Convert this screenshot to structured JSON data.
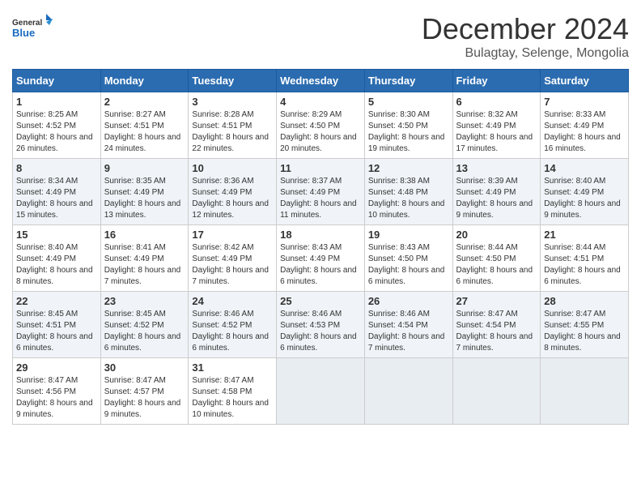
{
  "header": {
    "logo_general": "General",
    "logo_blue": "Blue",
    "month_title": "December 2024",
    "subtitle": "Bulagtay, Selenge, Mongolia"
  },
  "days_of_week": [
    "Sunday",
    "Monday",
    "Tuesday",
    "Wednesday",
    "Thursday",
    "Friday",
    "Saturday"
  ],
  "weeks": [
    [
      {
        "day": "1",
        "sunrise": "8:25 AM",
        "sunset": "4:52 PM",
        "daylight": "8 hours and 26 minutes"
      },
      {
        "day": "2",
        "sunrise": "8:27 AM",
        "sunset": "4:51 PM",
        "daylight": "8 hours and 24 minutes"
      },
      {
        "day": "3",
        "sunrise": "8:28 AM",
        "sunset": "4:51 PM",
        "daylight": "8 hours and 22 minutes"
      },
      {
        "day": "4",
        "sunrise": "8:29 AM",
        "sunset": "4:50 PM",
        "daylight": "8 hours and 20 minutes"
      },
      {
        "day": "5",
        "sunrise": "8:30 AM",
        "sunset": "4:50 PM",
        "daylight": "8 hours and 19 minutes"
      },
      {
        "day": "6",
        "sunrise": "8:32 AM",
        "sunset": "4:49 PM",
        "daylight": "8 hours and 17 minutes"
      },
      {
        "day": "7",
        "sunrise": "8:33 AM",
        "sunset": "4:49 PM",
        "daylight": "8 hours and 16 minutes"
      }
    ],
    [
      {
        "day": "8",
        "sunrise": "8:34 AM",
        "sunset": "4:49 PM",
        "daylight": "8 hours and 15 minutes"
      },
      {
        "day": "9",
        "sunrise": "8:35 AM",
        "sunset": "4:49 PM",
        "daylight": "8 hours and 13 minutes"
      },
      {
        "day": "10",
        "sunrise": "8:36 AM",
        "sunset": "4:49 PM",
        "daylight": "8 hours and 12 minutes"
      },
      {
        "day": "11",
        "sunrise": "8:37 AM",
        "sunset": "4:49 PM",
        "daylight": "8 hours and 11 minutes"
      },
      {
        "day": "12",
        "sunrise": "8:38 AM",
        "sunset": "4:48 PM",
        "daylight": "8 hours and 10 minutes"
      },
      {
        "day": "13",
        "sunrise": "8:39 AM",
        "sunset": "4:49 PM",
        "daylight": "8 hours and 9 minutes"
      },
      {
        "day": "14",
        "sunrise": "8:40 AM",
        "sunset": "4:49 PM",
        "daylight": "8 hours and 9 minutes"
      }
    ],
    [
      {
        "day": "15",
        "sunrise": "8:40 AM",
        "sunset": "4:49 PM",
        "daylight": "8 hours and 8 minutes"
      },
      {
        "day": "16",
        "sunrise": "8:41 AM",
        "sunset": "4:49 PM",
        "daylight": "8 hours and 7 minutes"
      },
      {
        "day": "17",
        "sunrise": "8:42 AM",
        "sunset": "4:49 PM",
        "daylight": "8 hours and 7 minutes"
      },
      {
        "day": "18",
        "sunrise": "8:43 AM",
        "sunset": "4:49 PM",
        "daylight": "8 hours and 6 minutes"
      },
      {
        "day": "19",
        "sunrise": "8:43 AM",
        "sunset": "4:50 PM",
        "daylight": "8 hours and 6 minutes"
      },
      {
        "day": "20",
        "sunrise": "8:44 AM",
        "sunset": "4:50 PM",
        "daylight": "8 hours and 6 minutes"
      },
      {
        "day": "21",
        "sunrise": "8:44 AM",
        "sunset": "4:51 PM",
        "daylight": "8 hours and 6 minutes"
      }
    ],
    [
      {
        "day": "22",
        "sunrise": "8:45 AM",
        "sunset": "4:51 PM",
        "daylight": "8 hours and 6 minutes"
      },
      {
        "day": "23",
        "sunrise": "8:45 AM",
        "sunset": "4:52 PM",
        "daylight": "8 hours and 6 minutes"
      },
      {
        "day": "24",
        "sunrise": "8:46 AM",
        "sunset": "4:52 PM",
        "daylight": "8 hours and 6 minutes"
      },
      {
        "day": "25",
        "sunrise": "8:46 AM",
        "sunset": "4:53 PM",
        "daylight": "8 hours and 6 minutes"
      },
      {
        "day": "26",
        "sunrise": "8:46 AM",
        "sunset": "4:54 PM",
        "daylight": "8 hours and 7 minutes"
      },
      {
        "day": "27",
        "sunrise": "8:47 AM",
        "sunset": "4:54 PM",
        "daylight": "8 hours and 7 minutes"
      },
      {
        "day": "28",
        "sunrise": "8:47 AM",
        "sunset": "4:55 PM",
        "daylight": "8 hours and 8 minutes"
      }
    ],
    [
      {
        "day": "29",
        "sunrise": "8:47 AM",
        "sunset": "4:56 PM",
        "daylight": "8 hours and 9 minutes"
      },
      {
        "day": "30",
        "sunrise": "8:47 AM",
        "sunset": "4:57 PM",
        "daylight": "8 hours and 9 minutes"
      },
      {
        "day": "31",
        "sunrise": "8:47 AM",
        "sunset": "4:58 PM",
        "daylight": "8 hours and 10 minutes"
      },
      null,
      null,
      null,
      null
    ]
  ]
}
